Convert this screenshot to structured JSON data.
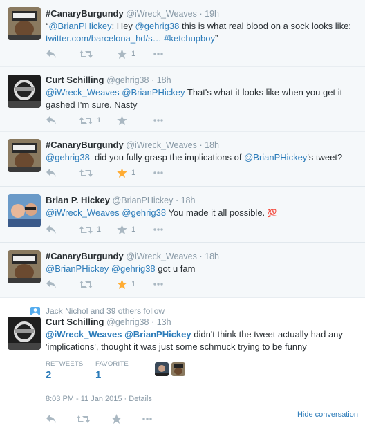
{
  "tweets": [
    {
      "name": "#CanaryBurgundy",
      "handle": "@iWreck_Weaves",
      "time": "· 19h",
      "line1_pre": "“",
      "line1_m1": "@BrianPHickey",
      "line1_mid": ": Hey ",
      "line1_m2": "@gehrig38",
      "line1_post": " this is what real blood on a sock looks like:",
      "line2_link": "twitter.com/barcelona_hd/s…",
      "line2_sp": " ",
      "line2_tag": "#ketchupboy",
      "line2_end": "”",
      "retweets": "",
      "favorites": "1"
    },
    {
      "name": "Curt Schilling",
      "handle": "@gehrig38",
      "time": "· 18h",
      "m1": "@iWreck_Weaves",
      "m2": "@BrianPHickey",
      "line1_post": " That's what it looks like when you get it",
      "line2": "gashed I'm sure. Nasty",
      "retweets": "1",
      "favorites": ""
    },
    {
      "name": "#CanaryBurgundy",
      "handle": "@iWreck_Weaves",
      "time": "· 18h",
      "m1": "@gehrig38",
      "pre": "  did you fully grasp the implications of ",
      "m2": "@BrianPHickey",
      "post": "'s tweet?",
      "retweets": "",
      "favorites": "1"
    },
    {
      "name": "Brian P. Hickey",
      "handle": "@BrianPHickey",
      "time": "· 18h",
      "m1": "@iWreck_Weaves",
      "m2": "@gehrig38",
      "post": " You made it all possible. ",
      "emoji": "💯",
      "retweets": "1",
      "favorites": "1"
    },
    {
      "name": "#CanaryBurgundy",
      "handle": "@iWreck_Weaves",
      "time": "· 18h",
      "m1": "@BrianPHickey",
      "m2": "@gehrig38",
      "post": " got u fam",
      "retweets": "",
      "favorites": "1"
    }
  ],
  "focus": {
    "context": "Jack Nichol and 39 others follow",
    "name": "Curt Schilling",
    "handle": "@gehrig38",
    "time": "· 13h",
    "m1": "@iWreck_Weaves",
    "m2": "@BrianPHickey",
    "line1_post": " didn't think the tweet actually had any",
    "line2": "'implications', thought it was just some schmuck trying to be funny",
    "retweets_label": "RETWEETS",
    "retweets": "2",
    "favorites_label": "FAVORITE",
    "favorites": "1",
    "timestamp": "8:03 PM - 11 Jan 2015",
    "details_sep": " · ",
    "details": "Details",
    "hide": "Hide conversation"
  },
  "colors": {
    "accent": "#2b7bb9",
    "star": "#ffac33",
    "muted": "#8899a6",
    "icon": "#aab8c2"
  },
  "icons": [
    "reply-icon",
    "retweet-icon",
    "star-icon",
    "more-icon",
    "person-icon"
  ]
}
